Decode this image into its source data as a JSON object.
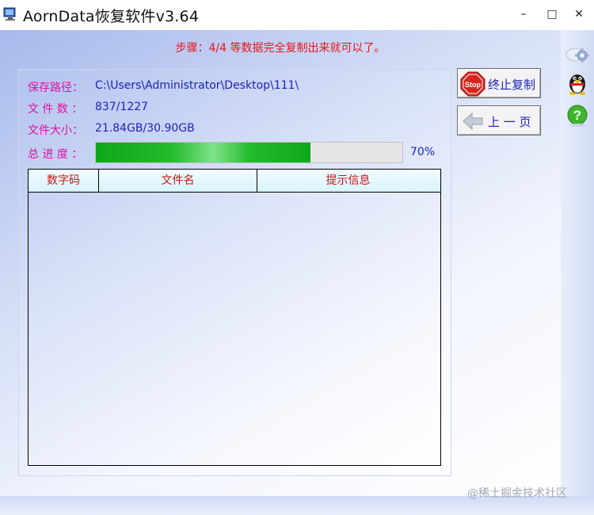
{
  "window": {
    "title": "AornData恢复软件v3.64",
    "minimize_glyph": "–",
    "maximize_glyph": "□",
    "close_glyph": "✕"
  },
  "step_text": "步骤：4/4 等数据完全复制出来就可以了。",
  "info": {
    "save_path_label": "保存路径：",
    "save_path_value": "C:\\Users\\Administrator\\Desktop\\111\\",
    "file_count_label": "文 件 数 ：",
    "file_count_value": "837/1227",
    "file_size_label": "文件大小：",
    "file_size_value": "21.84GB/30.90GB",
    "progress_label": "总 进 度 ：",
    "progress_percent": 70,
    "progress_text": "70%"
  },
  "table": {
    "columns": [
      "数字码",
      "文件名",
      "提示信息"
    ],
    "rows": []
  },
  "buttons": {
    "stop_label": "终止复制",
    "stop_icon_text": "Stop",
    "back_label": "上 一 页"
  },
  "side_icons": [
    "settings-gear-icon",
    "qq-penguin-icon",
    "help-question-icon"
  ],
  "watermark": "@稀土掘金技术社区",
  "colors": {
    "step_text": "#e8141b",
    "label": "#e30fa3",
    "value": "#1b24b8",
    "progress": "#17b21f",
    "header_text": "#d40e11"
  }
}
